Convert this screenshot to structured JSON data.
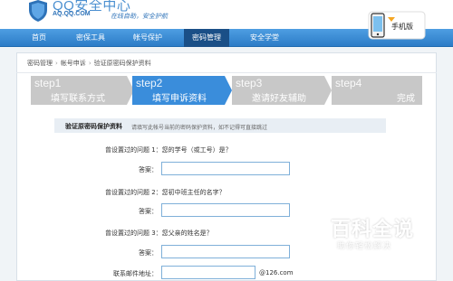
{
  "brand": {
    "title": "QQ安全中心",
    "domain": "AQ.QQ.COM",
    "slogan": "在线自助，安全护航",
    "phone_badge": "手机版"
  },
  "nav": {
    "items": [
      "首页",
      "密保工具",
      "帐号保护",
      "密码管理",
      "安全学堂"
    ],
    "active": "密码管理"
  },
  "breadcrumb": [
    "密码管理",
    "帐号申诉",
    "验证原密码保护资料"
  ],
  "steps": [
    {
      "num": "step1",
      "label": "填写联系方式"
    },
    {
      "num": "step2",
      "label": "填写申诉资料"
    },
    {
      "num": "step3",
      "label": "邀请好友辅助"
    },
    {
      "num": "step4",
      "label": "完成"
    }
  ],
  "active_step": 2,
  "form": {
    "section_title": "验证原密码保护资料",
    "section_hint": "请填写此帐号当前的密码保护资料，如不记得可直接跳过",
    "questions": [
      {
        "question": "曾设置过的问题 1：您的学号（或工号）是？",
        "answer_label": "答案：",
        "answer_value": ""
      },
      {
        "question": "曾设置过的问题 2：您初中班主任的名字？",
        "answer_label": "答案：",
        "answer_value": ""
      },
      {
        "question": "曾设置过的问题 3：您父亲的姓名是？",
        "answer_label": "答案：",
        "answer_value": ""
      }
    ],
    "email_label": "联系邮件地址：",
    "email_value": "",
    "email_suffix": "@126.com"
  },
  "watermark": {
    "title": "百科全说",
    "subtitle": "助你轻松解决"
  },
  "colors": {
    "nav_blue": "#3a8ddb",
    "nav_active": "#1a4f87",
    "step_inactive": "#c8c8c8",
    "input_border": "#7fb0d9"
  }
}
